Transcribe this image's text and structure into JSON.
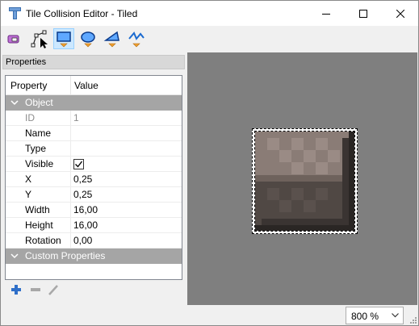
{
  "window": {
    "title": "Tile Collision Editor - Tiled"
  },
  "titlebar": {
    "app_icon": "tiled-app-icon",
    "minimize_icon": "minimize-icon",
    "maximize_icon": "maximize-icon",
    "close_icon": "close-icon"
  },
  "toolbar": {
    "tools": [
      {
        "name": "object-select",
        "icon": "select-objects-icon"
      },
      {
        "name": "edit-polygons",
        "icon": "edit-polygons-icon"
      },
      {
        "name": "rectangle",
        "icon": "insert-rectangle-icon",
        "active": true
      },
      {
        "name": "ellipse",
        "icon": "insert-ellipse-icon"
      },
      {
        "name": "polygon",
        "icon": "insert-polygon-icon"
      },
      {
        "name": "polyline",
        "icon": "insert-polyline-icon"
      }
    ],
    "accent": "#cce8ff"
  },
  "properties": {
    "dock_title": "Properties",
    "header": {
      "property": "Property",
      "value": "Value"
    },
    "groups": [
      {
        "label": "Object",
        "rows": [
          {
            "name": "ID",
            "value": "1",
            "disabled": true
          },
          {
            "name": "Name",
            "value": ""
          },
          {
            "name": "Type",
            "value": ""
          },
          {
            "name": "Visible",
            "value": "",
            "checked": true
          },
          {
            "name": "X",
            "value": "0,25"
          },
          {
            "name": "Y",
            "value": "0,25"
          },
          {
            "name": "Width",
            "value": "16,00"
          },
          {
            "name": "Height",
            "value": "16,00"
          },
          {
            "name": "Rotation",
            "value": "0,00"
          }
        ]
      },
      {
        "label": "Custom Properties",
        "rows": []
      }
    ],
    "group_color": "#a5a5a5",
    "bottom_tools": [
      "add-property-icon",
      "remove-property-icon",
      "rename-property-icon"
    ]
  },
  "canvas": {
    "background": "#7f7f7f"
  },
  "status": {
    "zoom": "800 %"
  }
}
